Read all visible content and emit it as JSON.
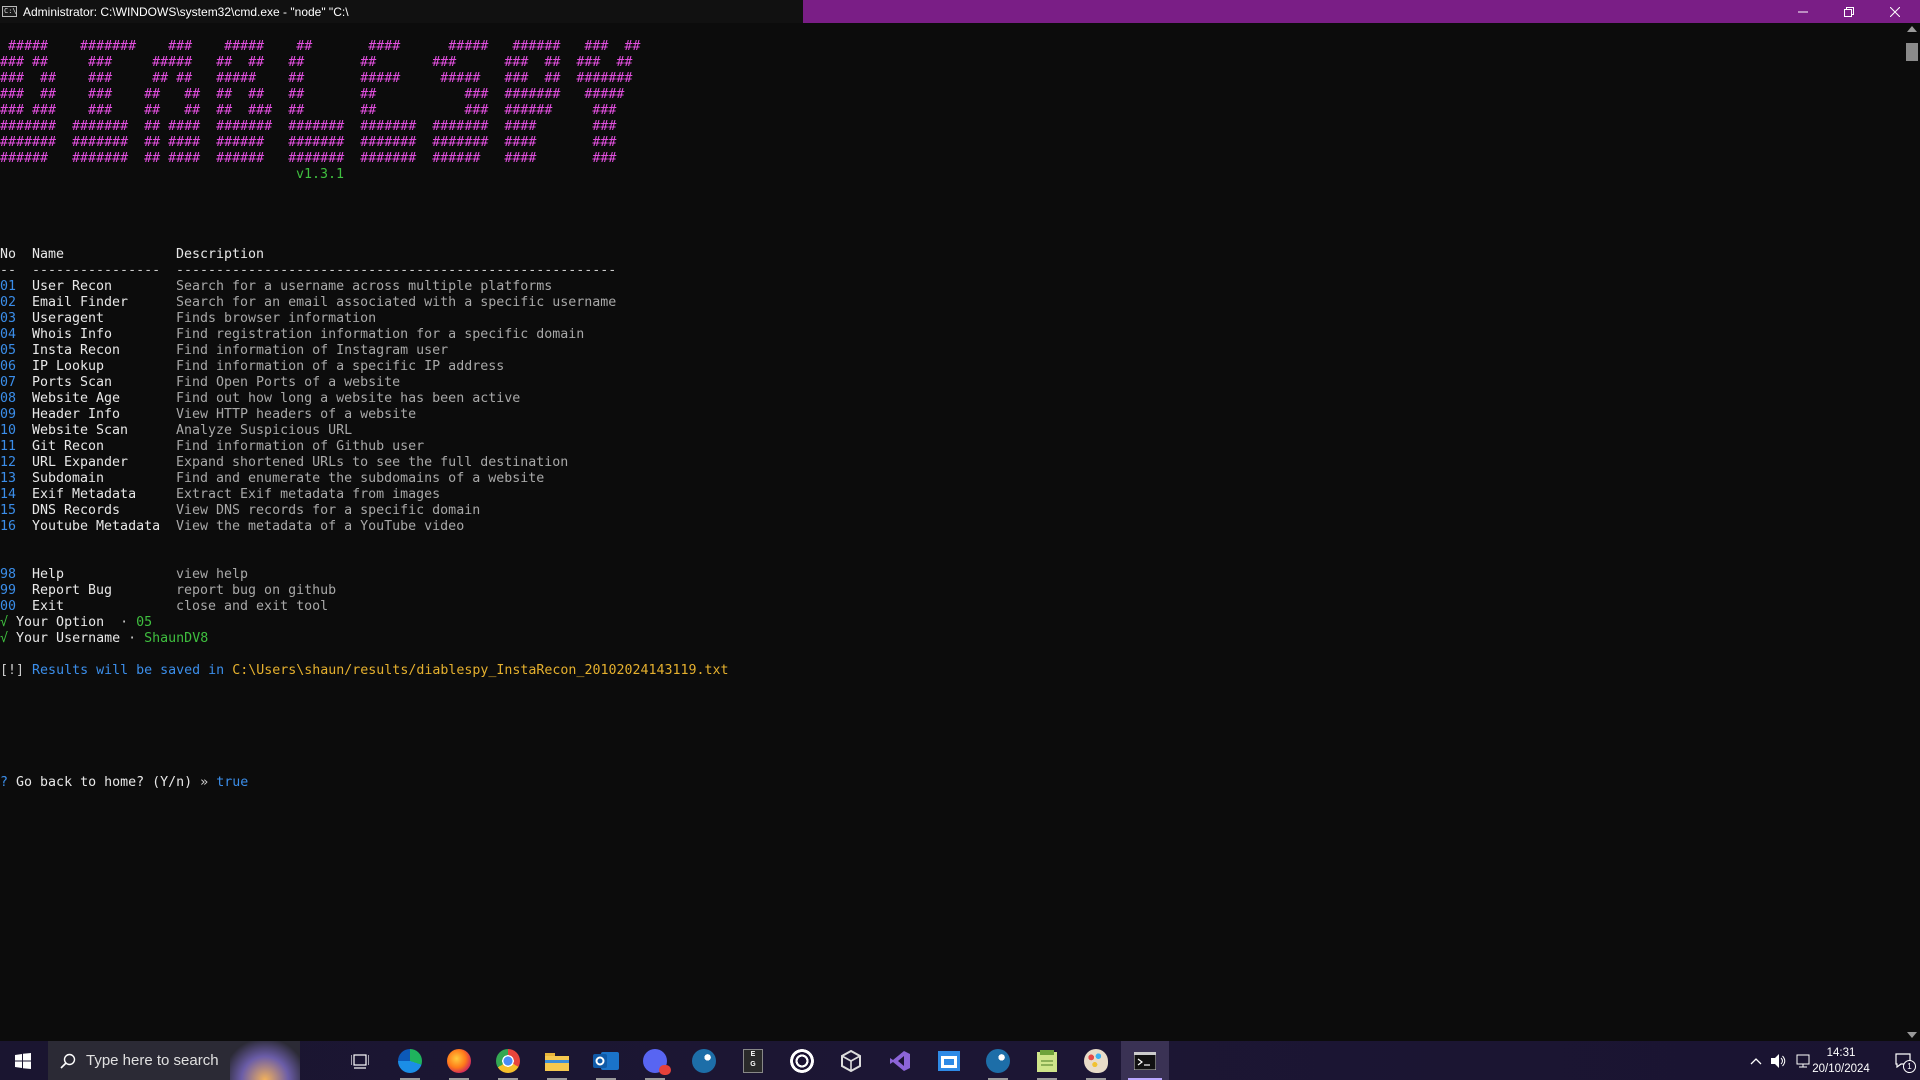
{
  "window": {
    "title": "Administrator:  C:\\WINDOWS\\system32\\cmd.exe - \"node\"  \"C:\\",
    "icon_text": "C:\\",
    "controls": [
      "minimize-icon",
      "restore-icon",
      "close-icon"
    ]
  },
  "banner": {
    "lines": [
      " #####    #######    ###    #####    ##       ####      #####   ######   ###  ##",
      "### ##     ###     #####   ##  ##   ##       ##       ###      ###  ##  ###  ##",
      "###  ##    ###     ## ##   #####    ##       #####     #####   ###  ##  #######",
      "###  ##    ###    ##   ##  ##  ##   ##       ##           ###  #######   #####",
      "### ###    ###    ##   ##  ##  ###  ##       ##           ###  ######     ###",
      "#######  #######  ## ####  #######  #######  #######  #######  ####       ###",
      "#######  #######  ## ####  ######   #######  #######  #######  ####       ###",
      "######   #######  ## ####  ######   #######  #######  ######   ####       ###"
    ],
    "version": "v1.3.1"
  },
  "menu": {
    "headers": {
      "no": "No",
      "name": "Name",
      "description": "Description"
    },
    "separator": {
      "no": "--",
      "name": "----------------",
      "description": "-------------------------------------------------------"
    },
    "items": [
      {
        "no": "01",
        "name": "User Recon",
        "description": "Search for a username across multiple platforms"
      },
      {
        "no": "02",
        "name": "Email Finder",
        "description": "Search for an email associated with a specific username"
      },
      {
        "no": "03",
        "name": "Useragent",
        "description": "Finds browser information"
      },
      {
        "no": "04",
        "name": "Whois Info",
        "description": "Find registration information for a specific domain"
      },
      {
        "no": "05",
        "name": "Insta Recon",
        "description": "Find information of Instagram user"
      },
      {
        "no": "06",
        "name": "IP Lookup",
        "description": "Find information of a specific IP address"
      },
      {
        "no": "07",
        "name": "Ports Scan",
        "description": "Find Open Ports of a website"
      },
      {
        "no": "08",
        "name": "Website Age",
        "description": "Find out how long a website has been active"
      },
      {
        "no": "09",
        "name": "Header Info",
        "description": "View HTTP headers of a website"
      },
      {
        "no": "10",
        "name": "Website Scan",
        "description": "Analyze Suspicious URL"
      },
      {
        "no": "11",
        "name": "Git Recon",
        "description": "Find information of Github user"
      },
      {
        "no": "12",
        "name": "URL Expander",
        "description": "Expand shortened URLs to see the full destination"
      },
      {
        "no": "13",
        "name": "Subdomain",
        "description": "Find and enumerate the subdomains of a website"
      },
      {
        "no": "14",
        "name": "Exif Metadata",
        "description": "Extract Exif metadata from images"
      },
      {
        "no": "15",
        "name": "DNS Records",
        "description": "View DNS records for a specific domain"
      },
      {
        "no": "16",
        "name": "Youtube Metadata",
        "description": "View the metadata of a YouTube video"
      }
    ],
    "extra_items": [
      {
        "no": "98",
        "name": "Help",
        "description": "view help"
      },
      {
        "no": "99",
        "name": "Report Bug",
        "description": "report bug on github"
      },
      {
        "no": "00",
        "name": "Exit",
        "description": "close and exit tool"
      }
    ]
  },
  "prompts": {
    "check": "√",
    "option_label": "Your Option",
    "dot": "·",
    "option_value": "05",
    "username_label": "Your Username",
    "username_value": "ShaunDV8",
    "info_prefix": "[!]",
    "info_text": "Results will be saved in",
    "info_path": "C:\\Users\\shaun/results/diablespy_InstaRecon_20102024143119.txt",
    "question_mark": "?",
    "question": "Go back to home? (Y/n)",
    "arrow": "»",
    "answer": "true"
  },
  "taskbar": {
    "search_placeholder": "Type here to search",
    "apps": [
      "task-view-icon",
      "edge-icon",
      "firefox-icon",
      "chrome-icon",
      "file-explorer-icon",
      "outlook-icon",
      "discord-icon",
      "steam-icon",
      "epic-games-icon",
      "ubisoft-icon",
      "unity-icon",
      "visual-studio-icon",
      "app-window-icon",
      "steam-icon",
      "notepad-plus-icon",
      "paint-icon",
      "terminal-icon"
    ],
    "time": "14:31",
    "date": "20/10/2024",
    "notification_count": "1"
  },
  "colors": {
    "titlebar": "#7a1e86",
    "banner": "#e34fe0",
    "version": "#3fbf3f",
    "number": "#3b8eea",
    "path": "#e5b02e"
  }
}
